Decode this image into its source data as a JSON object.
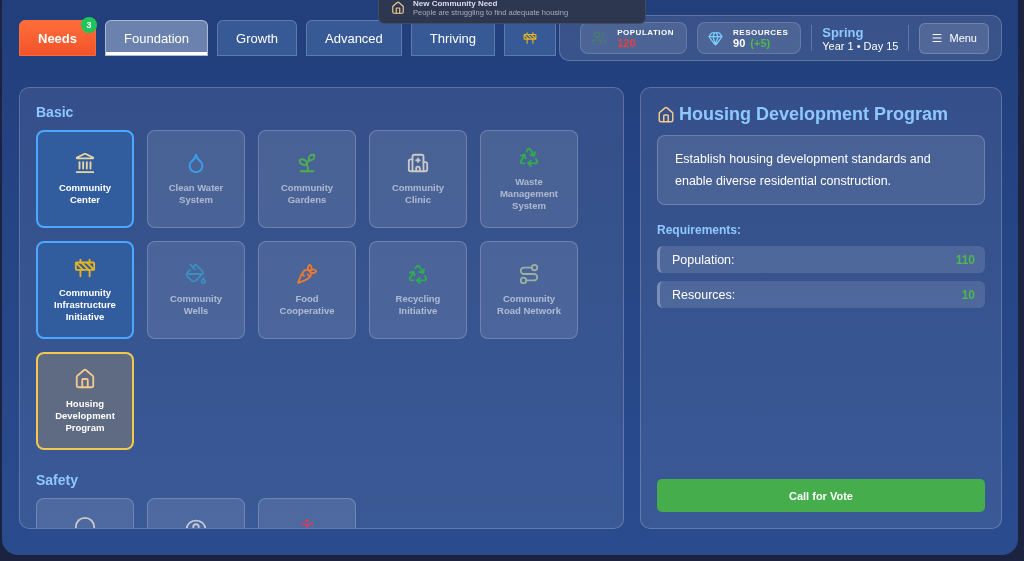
{
  "toast": {
    "title": "New Community Need",
    "message": "People are struggling to find adequate housing"
  },
  "tabs": [
    {
      "kind": "needs",
      "label": "Needs",
      "badge": "3",
      "selected": false
    },
    {
      "kind": "tier",
      "label": "Foundation",
      "selected": true
    },
    {
      "kind": "tier",
      "label": "Growth",
      "selected": false
    },
    {
      "kind": "tier",
      "label": "Advanced",
      "selected": false
    },
    {
      "kind": "tier",
      "label": "Thriving",
      "selected": false
    },
    {
      "kind": "icon",
      "selected": false
    }
  ],
  "stats": {
    "population": {
      "label": "POPULATION",
      "value": "120"
    },
    "resources": {
      "label": "RESOURCES",
      "value": "90",
      "delta": "(+5)"
    },
    "season": "Spring",
    "date": "Year 1 • Day 15",
    "menu": "Menu"
  },
  "sections": [
    {
      "title": "Basic",
      "items": [
        {
          "name": "Community Center",
          "unlocked": true,
          "selected": false
        },
        {
          "name": "Clean Water System",
          "unlocked": false,
          "selected": false
        },
        {
          "name": "Community Gardens",
          "unlocked": false,
          "selected": false
        },
        {
          "name": "Community Clinic",
          "unlocked": false,
          "selected": false
        },
        {
          "name": "Waste Management System",
          "unlocked": false,
          "selected": false
        },
        {
          "name": "Community Infrastructure Initiative",
          "unlocked": true,
          "selected": false
        },
        {
          "name": "Community Wells",
          "unlocked": false,
          "selected": false
        },
        {
          "name": "Food Cooperative",
          "unlocked": false,
          "selected": false
        },
        {
          "name": "Recycling Initiative",
          "unlocked": false,
          "selected": false
        },
        {
          "name": "Community Road Network",
          "unlocked": false,
          "selected": false
        },
        {
          "name": "Housing Development Program",
          "unlocked": false,
          "selected": true
        }
      ]
    },
    {
      "title": "Safety",
      "items": [
        {
          "unlocked": false,
          "selected": false
        },
        {
          "unlocked": false,
          "selected": false
        },
        {
          "unlocked": false,
          "selected": false
        }
      ]
    }
  ],
  "detail": {
    "title": "Housing Development Program",
    "description": "Establish housing development standards and enable diverse residential construction.",
    "requirements_label": "Requirements:",
    "requirements": [
      {
        "label": "Population:",
        "value": "110"
      },
      {
        "label": "Resources:",
        "value": "10"
      }
    ],
    "action": "Call for Vote"
  }
}
